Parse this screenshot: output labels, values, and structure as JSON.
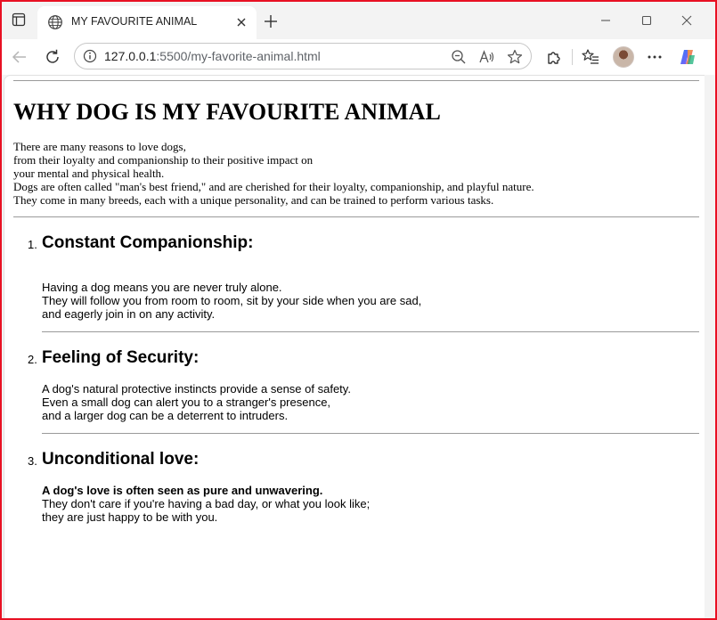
{
  "browser": {
    "tab_title": "MY FAVOURITE ANIMAL",
    "url_host": "127.0.0.1",
    "url_path": ":5500/my-favorite-animal.html"
  },
  "page": {
    "title": "WHY DOG IS MY FAVOURITE ANIMAL",
    "intro_lines": [
      "There are many reasons to love dogs,",
      "from their loyalty and companionship to their positive impact on",
      "your mental and physical health.",
      "Dogs are often called \"man's best friend,\" and are cherished for their loyalty, companionship, and playful nature.",
      "They come in many breeds, each with a unique personality, and can be trained to perform various tasks."
    ],
    "sections": [
      {
        "number": "1.",
        "heading": "Constant Companionship:",
        "lines": [
          "Having a dog means you are never truly alone.",
          "They will follow you from room to room, sit by your side when you are sad,",
          "and eagerly join in on any activity."
        ]
      },
      {
        "number": "2.",
        "heading": "Feeling of Security:",
        "lines": [
          "A dog's natural protective instincts provide a sense of safety.",
          "Even a small dog can alert you to a stranger's presence,",
          "and a larger dog can be a deterrent to intruders."
        ]
      },
      {
        "number": "3.",
        "heading": "Unconditional love:",
        "bold_line": "A dog's love is often seen as pure and unwavering.",
        "lines": [
          "They don't care if you're having a bad day, or what you look like;",
          "they are just happy to be with you."
        ]
      }
    ]
  },
  "colors": {
    "frame_border": "#e81123",
    "chrome_bg": "#f3f3f3",
    "rule": "#9a9a9a"
  }
}
